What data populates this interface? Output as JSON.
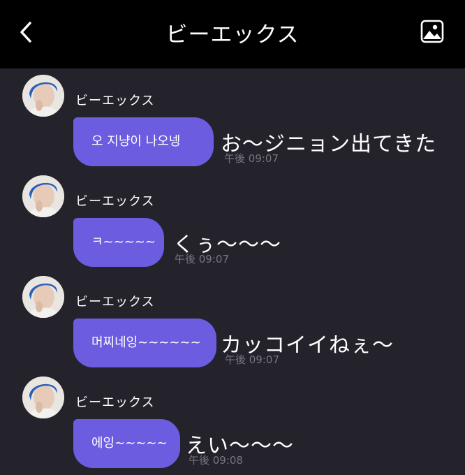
{
  "header": {
    "title": "ビーエックス",
    "back_icon": "chevron-left-icon",
    "gallery_icon": "image-icon"
  },
  "colors": {
    "bubble": "#6c5ce0",
    "chat_background": "#24232c",
    "header_background": "#000000",
    "time_text": "#777680"
  },
  "messages": [
    {
      "sender": "ビーエックス",
      "text": "오 지냥이 나오넹",
      "translation": "お〜ジニョン出てきた",
      "time": "午後 09:07"
    },
    {
      "sender": "ビーエックス",
      "text": "ㅋ~~~~~",
      "translation": "くぅ〜〜〜",
      "time": "午後 09:07"
    },
    {
      "sender": "ビーエックス",
      "text": "머찌네잉~~~~~~",
      "translation": "カッコイイねぇ〜",
      "time": "午後 09:07"
    },
    {
      "sender": "ビーエックス",
      "text": "에잉~~~~~",
      "translation": "えい〜〜〜",
      "time": "午後 09:08"
    }
  ]
}
